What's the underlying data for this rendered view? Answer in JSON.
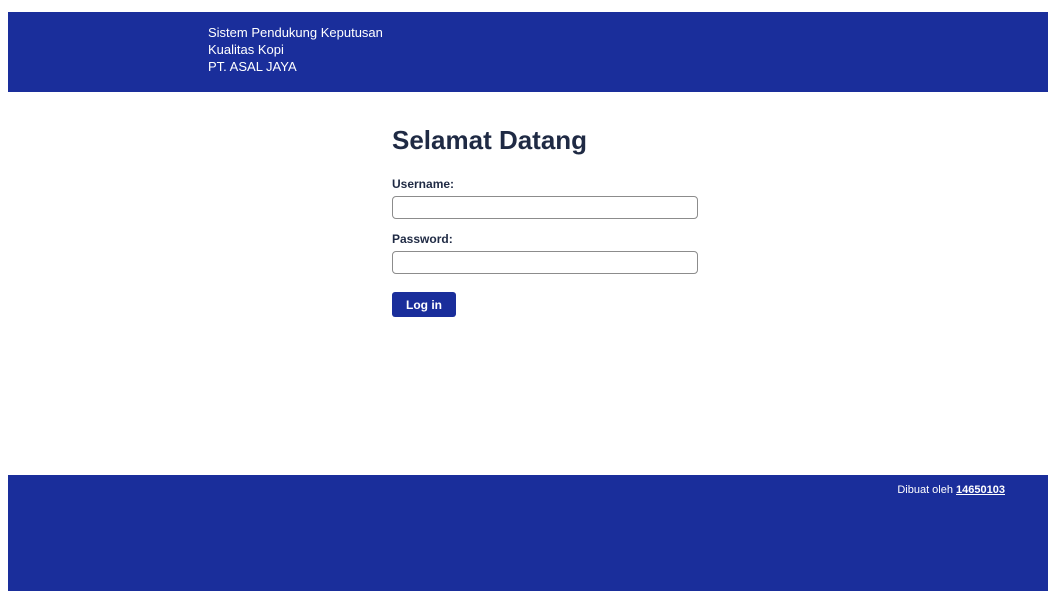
{
  "header": {
    "line1": "Sistem Pendukung Keputusan",
    "line2": "Kualitas Kopi",
    "line3": "PT. ASAL JAYA",
    "background_color": "#1a2e9b"
  },
  "login": {
    "title": "Selamat Datang",
    "username_label": "Username:",
    "username_value": "",
    "password_label": "Password:",
    "password_value": "",
    "submit_label": "Log in",
    "button_color": "#1a2e9b"
  },
  "footer": {
    "credit_prefix": "Dibuat oleh ",
    "credit_link": "14650103",
    "background_color": "#1a2e9b"
  }
}
